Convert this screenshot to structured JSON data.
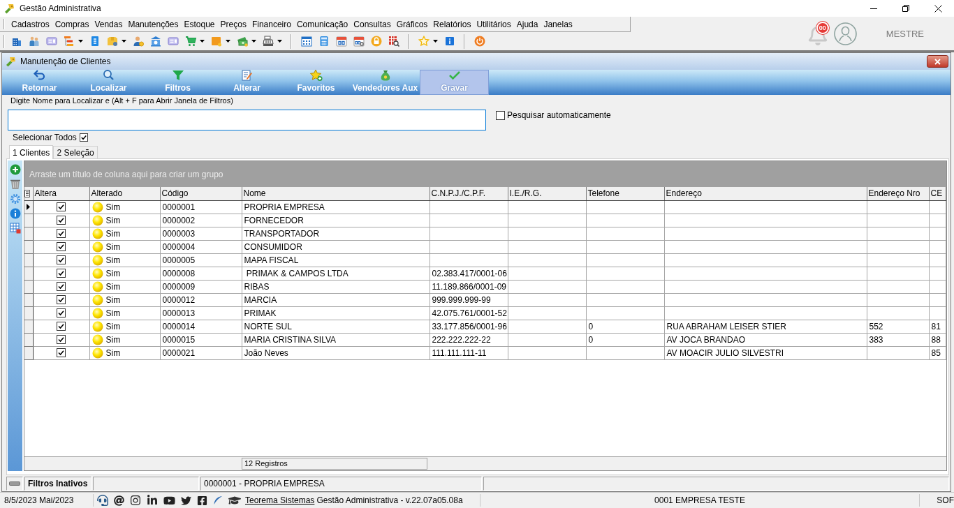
{
  "window": {
    "title": "Gestão Administrativa"
  },
  "menu": [
    "Cadastros",
    "Compras",
    "Vendas",
    "Manutenções",
    "Estoque",
    "Preços",
    "Financeiro",
    "Comunicação",
    "Consultas",
    "Gráficos",
    "Relatórios",
    "Utilitários",
    "Ajuda",
    "Janelas"
  ],
  "toolbar": [
    {
      "items": [
        {
          "dropdown": false
        },
        {
          "dropdown": false
        },
        {
          "dropdown": false
        },
        {
          "dropdown": true
        },
        {
          "dropdown": false
        },
        {
          "dropdown": true
        },
        {
          "dropdown": false
        },
        {
          "dropdown": false
        },
        {
          "dropdown": false
        },
        {
          "dropdown": true
        },
        {
          "dropdown": true
        },
        {
          "dropdown": true
        },
        {
          "dropdown": true
        }
      ]
    },
    {
      "items": [
        {
          "dropdown": false
        },
        {
          "dropdown": false
        },
        {
          "dropdown": false
        },
        {
          "dropdown": false
        },
        {
          "dropdown": false
        },
        {
          "dropdown": false
        }
      ]
    },
    {
      "items": [
        {
          "dropdown": true
        },
        {
          "dropdown": false
        }
      ]
    },
    {
      "items": [
        {
          "dropdown": false
        }
      ]
    }
  ],
  "notifications": {
    "badge": "00"
  },
  "user": {
    "name": "MESTRE"
  },
  "child_window": {
    "title": "Manutenção de Clientes",
    "actions": [
      {
        "label": "Retornar",
        "highlighted": false
      },
      {
        "label": "Localizar",
        "highlighted": false
      },
      {
        "label": "Filtros",
        "highlighted": false
      },
      {
        "label": "Alterar",
        "highlighted": false
      },
      {
        "label": "Favoritos",
        "highlighted": false
      },
      {
        "label": "Vendedores Aux",
        "highlighted": false
      },
      {
        "label": "Gravar",
        "highlighted": true
      }
    ],
    "search": {
      "label": "Digite Nome para Localizar e (Alt + F para Abrir Janela de Filtros)"
    },
    "auto_search": {
      "label": "Pesquisar automaticamente",
      "checked": false
    },
    "select_all": {
      "label": "Selecionar Todos",
      "checked": true
    },
    "tabs": [
      {
        "label": "1 Clientes",
        "selected": true
      },
      {
        "label": "2 Seleção",
        "selected": false
      }
    ],
    "grid": {
      "group_hint": "Arraste um título de coluna aqui para criar um grupo",
      "columns": [
        {
          "label": "Altera",
          "kind": "check"
        },
        {
          "label": "Alterado",
          "kind": "status"
        },
        {
          "label": "Código",
          "kind": "text"
        },
        {
          "label": "Nome",
          "kind": "text"
        },
        {
          "label": "C.N.P.J./C.P.F.",
          "kind": "text"
        },
        {
          "label": "I.E./R.G.",
          "kind": "text"
        },
        {
          "label": "Telefone",
          "kind": "text"
        },
        {
          "label": "Endereço",
          "kind": "text"
        },
        {
          "label": "Endereço Nro",
          "kind": "text"
        },
        {
          "label": "CE",
          "kind": "text"
        }
      ],
      "rows": [
        {
          "current": true,
          "altera": true,
          "alterado": "Sim",
          "codigo": "0000001",
          "nome": "PROPRIA EMPRESA"
        },
        {
          "current": false,
          "altera": true,
          "alterado": "Sim",
          "codigo": "0000002",
          "nome": "FORNECEDOR"
        },
        {
          "current": false,
          "altera": true,
          "alterado": "Sim",
          "codigo": "0000003",
          "nome": "TRANSPORTADOR"
        },
        {
          "current": false,
          "altera": true,
          "alterado": "Sim",
          "codigo": "0000004",
          "nome": "CONSUMIDOR"
        },
        {
          "current": false,
          "altera": true,
          "alterado": "Sim",
          "codigo": "0000005",
          "nome": "MAPA FISCAL"
        },
        {
          "current": false,
          "altera": true,
          "alterado": "Sim",
          "codigo": "0000008",
          "nome": " PRIMAK & CAMPOS LTDA",
          "cnpj_cpf": "02.383.417/0001-06"
        },
        {
          "current": false,
          "altera": true,
          "alterado": "Sim",
          "codigo": "0000009",
          "nome": "RIBAS",
          "cnpj_cpf": "11.189.866/0001-09"
        },
        {
          "current": false,
          "altera": true,
          "alterado": "Sim",
          "codigo": "0000012",
          "nome": "MARCIA",
          "cnpj_cpf": "999.999.999-99"
        },
        {
          "current": false,
          "altera": true,
          "alterado": "Sim",
          "codigo": "0000013",
          "nome": "PRIMAK",
          "cnpj_cpf": "42.075.761/0001-52"
        },
        {
          "current": false,
          "altera": true,
          "alterado": "Sim",
          "codigo": "0000014",
          "nome": "NORTE SUL",
          "cnpj_cpf": "33.177.856/0001-96",
          "telefone": "0",
          "endereco": "RUA ABRAHAM LEISER STIER",
          "endereco_nro": "552",
          "ce": "81"
        },
        {
          "current": false,
          "altera": true,
          "alterado": "Sim",
          "codigo": "0000015",
          "nome": "MARIA CRISTINA SILVA",
          "cnpj_cpf": "222.222.222-22",
          "telefone": "0",
          "endereco": "AV JOCA BRANDAO",
          "endereco_nro": "383",
          "ce": "88"
        },
        {
          "current": false,
          "altera": true,
          "alterado": "Sim",
          "codigo": "0000021",
          "nome": "João Neves",
          "cnpj_cpf": "111.111.111-11",
          "endereco": "AV MOACIR JULIO SILVESTRI",
          "ce": "85"
        }
      ],
      "footer": "12 Registros"
    },
    "status_bar": {
      "filters": "Filtros Inativos",
      "record": "0000001 - PROPRIA EMPRESA"
    }
  },
  "app_status_bar": {
    "date": "8/5/2023 Mai/2023",
    "link": "Teorema Sistemas",
    "version": "Gestão Administrativa - v.22.07a05.08a",
    "company": "0001 EMPRESA TESTE",
    "panel_5": "SOF"
  }
}
